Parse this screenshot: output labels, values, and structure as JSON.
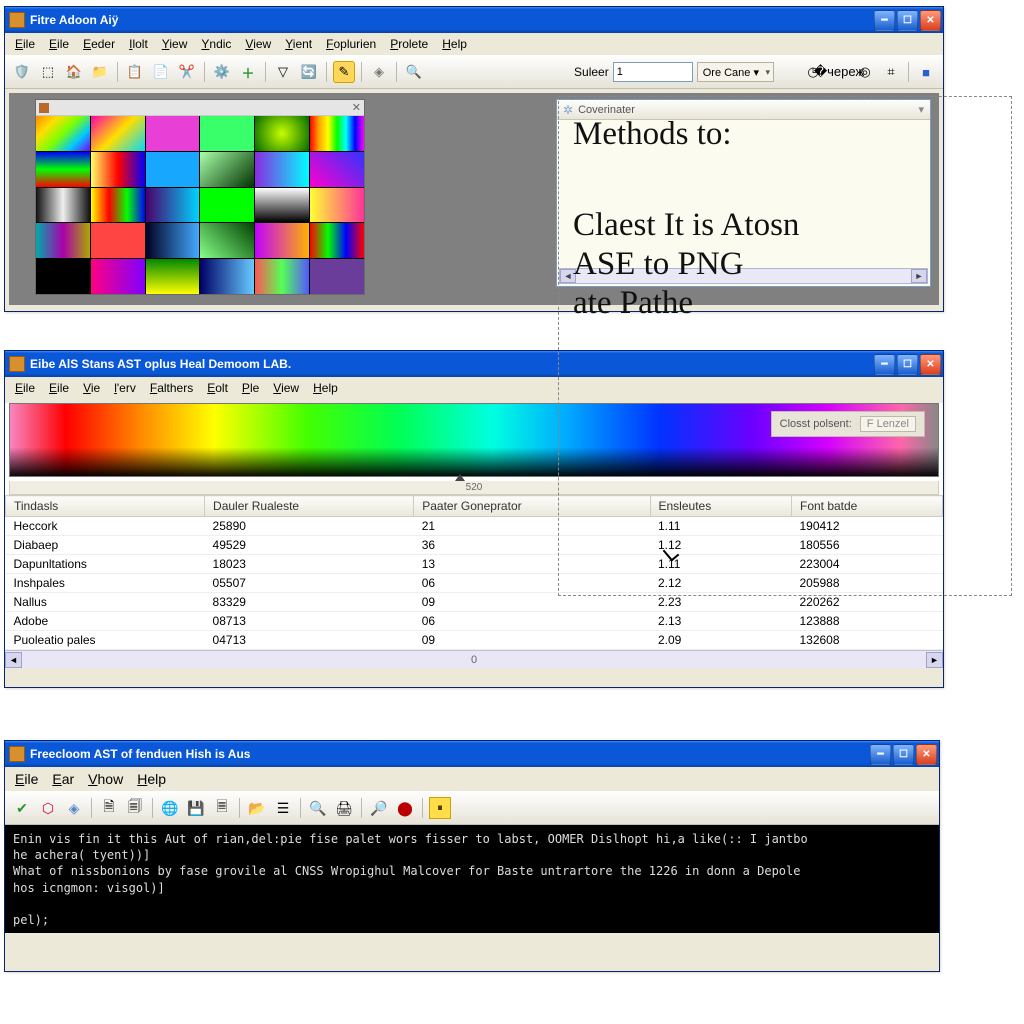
{
  "window1": {
    "title": "Fitre Adoon Aiÿ",
    "menu": [
      "Eile",
      "Eile",
      "Eeder",
      "Ilolt",
      "Yiew",
      "Yndic",
      "View",
      "Yient",
      "Foplurien",
      "Prolete",
      "Help"
    ],
    "toolbar": {
      "suleer_label": "Suleer",
      "suleer_value": "1",
      "ore_cane_label": "Ore Cane ▾"
    },
    "side_tab": "Coverinater"
  },
  "window2": {
    "title": "Eibe AlS Stans AST oplus Heal Demoom LAB.",
    "menu": [
      "Eile",
      "Eile",
      "Vie",
      "l'erv",
      "Falthers",
      "Eolt",
      "Ple",
      "View",
      "Help"
    ],
    "selector_label": "Closst polsent:",
    "selector_value": "F Lenzel",
    "ruler_mark": "520",
    "columns": [
      "Tindasls",
      "Dauler Rualeste",
      "Paater Goneprator",
      "Ensleutes",
      "Font batde"
    ],
    "rows": [
      {
        "c0": "Heccork",
        "c1": "25890",
        "c2": "21",
        "c3": "1.11",
        "c4": "190412"
      },
      {
        "c0": "Diabaep",
        "c1": "49529",
        "c2": "36",
        "c3": "1.12",
        "c4": "180556"
      },
      {
        "c0": "Dapunltations",
        "c1": "18023",
        "c2": "13",
        "c3": "1.11",
        "c4": "223004"
      },
      {
        "c0": "Inshpales",
        "c1": "05507",
        "c2": "06",
        "c3": "2.12",
        "c4": "205988"
      },
      {
        "c0": "Nallus",
        "c1": "83329",
        "c2": "09",
        "c3": "2.23",
        "c4": "220262"
      },
      {
        "c0": "Adobe",
        "c1": "08713",
        "c2": "06",
        "c3": "2.13",
        "c4": "123888"
      },
      {
        "c0": "Puoleatio pales",
        "c1": "04713",
        "c2": "09",
        "c3": "2.09",
        "c4": "132608"
      }
    ],
    "scroll_value": "0"
  },
  "window3": {
    "title": "Freecloom AST of fenduen Hish is Aus",
    "menu": [
      "Eile",
      "Ear",
      "Vhow",
      "Help"
    ],
    "terminal_lines": [
      "Enin vis fin it this Aut of rian,del:pie fise palet wors fisser to labst, OOMER Dislhopt hi,a like(:: I jantbo",
      "he achera( tyent))]",
      "What of nissbonions by fase grovile al CNSS Wropighul Malcover for Baste untrartore the 1226 in donn a Depole",
      "hos icngmon: visgol)]",
      "",
      "pel);"
    ]
  },
  "overlay": {
    "line1": "Methods to:",
    "line2": "Claest It is Atosn",
    "line3": "ASE to PNG",
    "line4": "ate Pathe"
  },
  "swatches": [
    "linear-gradient(135deg,#ff8a00,#ffde00,#7cff00,#00c8ff,#7a00ff)",
    "linear-gradient(135deg,#ff00a8,#ffdf00,#00d9ff)",
    "#e83fd6",
    "#39ff6b",
    "radial-gradient(circle,#c6ff00,#006a00)",
    "linear-gradient(90deg,#ff0000,#ffa500,#ffff00,#00ff00,#00ffff,#0000ff,#ff00ff)",
    "linear-gradient(0deg,#ff0000,#00ff00,#0000ff)",
    "linear-gradient(90deg,#ff6,#f00,#00f)",
    "#18a7ff",
    "linear-gradient(135deg,#aaffaa,#003300)",
    "linear-gradient(90deg,#8a2be2,#00ffff)",
    "linear-gradient(45deg,#ff00cc,#3333ff)",
    "linear-gradient(90deg,#111,#eee,#111)",
    "linear-gradient(90deg,#ff0,#f00,#0f0,#00f)",
    "linear-gradient(90deg,#4a006a,#00d4ff)",
    "#00ff00",
    "linear-gradient(0deg,#000,#fff)",
    "linear-gradient(90deg,#ff3,#f39)",
    "linear-gradient(90deg,#0aa,#a0a,#aa0)",
    "#ff4444",
    "linear-gradient(90deg,#002,#4af)",
    "linear-gradient(45deg,#8f8,#004400)",
    "linear-gradient(90deg,#c200ff,#ffb300)",
    "linear-gradient(90deg,#f00,#0f0,#00f,#f00)",
    "#000000",
    "linear-gradient(90deg,#ff0080,#8000ff)",
    "linear-gradient(0deg,#ff0,#080)",
    "linear-gradient(90deg,#006,#6cf)",
    "linear-gradient(90deg,#f55,#5f5,#55f)",
    "#6a3d9a"
  ],
  "strip_colors": [
    "#ff0000",
    "#ff8800",
    "#ffff00",
    "#55ff00",
    "#00ff88",
    "#00eaff",
    "#0055ff",
    "#6600ff",
    "#dd00ff",
    "#ff0088",
    "#888888",
    "#000000"
  ]
}
